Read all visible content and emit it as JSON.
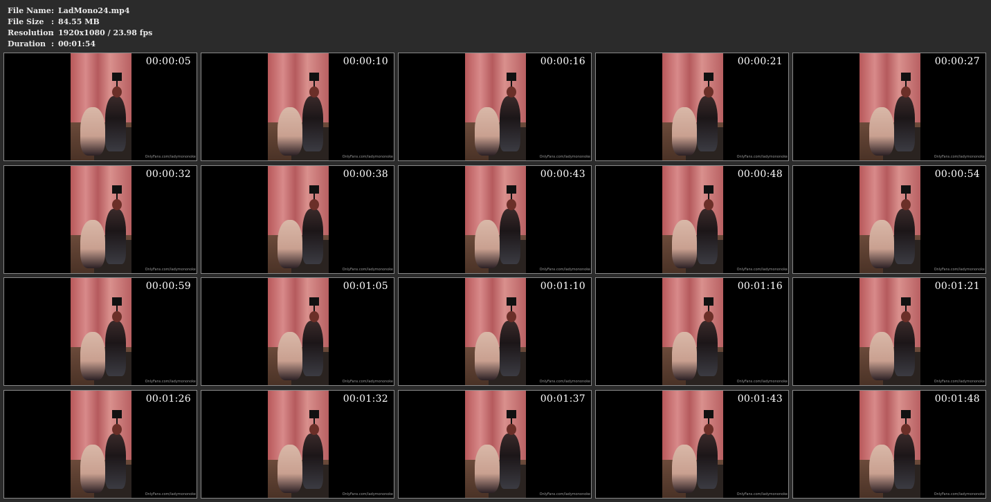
{
  "header": {
    "rows": [
      {
        "label": "File Name",
        "value": "LadMono24.mp4"
      },
      {
        "label": "File Size",
        "value": "84.55 MB"
      },
      {
        "label": "Resolution",
        "value": "1920x1080 / 23.98 fps"
      },
      {
        "label": "Duration",
        "value": "00:01:54"
      }
    ]
  },
  "thumbs": [
    {
      "ts": "00:00:05"
    },
    {
      "ts": "00:00:10"
    },
    {
      "ts": "00:00:16"
    },
    {
      "ts": "00:00:21"
    },
    {
      "ts": "00:00:27"
    },
    {
      "ts": "00:00:32"
    },
    {
      "ts": "00:00:38"
    },
    {
      "ts": "00:00:43"
    },
    {
      "ts": "00:00:48"
    },
    {
      "ts": "00:00:54"
    },
    {
      "ts": "00:00:59"
    },
    {
      "ts": "00:01:05"
    },
    {
      "ts": "00:01:10"
    },
    {
      "ts": "00:01:16"
    },
    {
      "ts": "00:01:21"
    },
    {
      "ts": "00:01:26"
    },
    {
      "ts": "00:01:32"
    },
    {
      "ts": "00:01:37"
    },
    {
      "ts": "00:01:43"
    },
    {
      "ts": "00:01:48"
    }
  ],
  "watermark": "OnlyFans.com/ladymononoke"
}
